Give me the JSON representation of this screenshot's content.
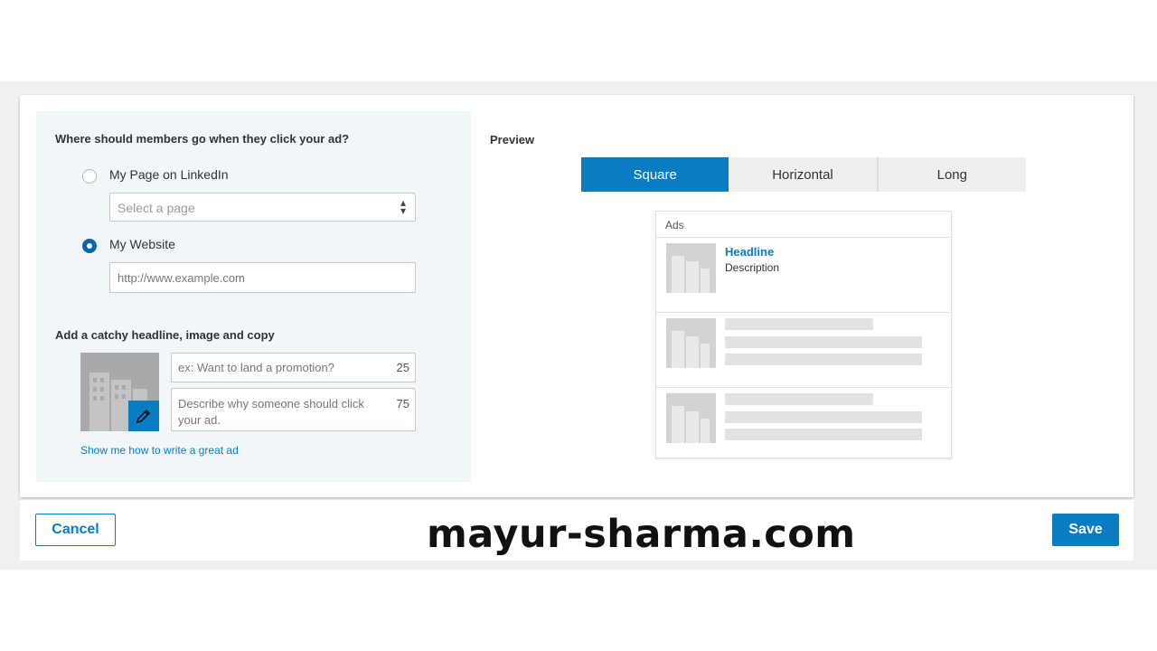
{
  "destination": {
    "question": "Where should members go when they click your ad?",
    "option_page_label": "My Page on LinkedIn",
    "select_placeholder": "Select a page",
    "option_website_label": "My Website",
    "website_placeholder": "http://www.example.com"
  },
  "creative": {
    "title": "Add a catchy headline, image and copy",
    "headline_placeholder": "ex: Want to land a promotion?",
    "headline_count": "25",
    "description_placeholder": "Describe why someone should click your ad.",
    "description_count": "75",
    "help_link": "Show me how to write a great ad"
  },
  "preview": {
    "title": "Preview",
    "tabs": [
      {
        "label": "Square",
        "active": true
      },
      {
        "label": "Horizontal",
        "active": false
      },
      {
        "label": "Long",
        "active": false
      }
    ],
    "ads_label": "Ads",
    "headline": "Headline",
    "description": "Description"
  },
  "footer": {
    "cancel_label": "Cancel",
    "save_label": "Save",
    "watermark": "mayur-sharma.com"
  },
  "colors": {
    "accent": "#0a7cc4",
    "panel_bg": "#f1f6f9"
  },
  "icons": [
    "radio-unchecked-icon",
    "radio-checked-icon",
    "select-caret-icon",
    "pencil-icon",
    "building-icon"
  ]
}
